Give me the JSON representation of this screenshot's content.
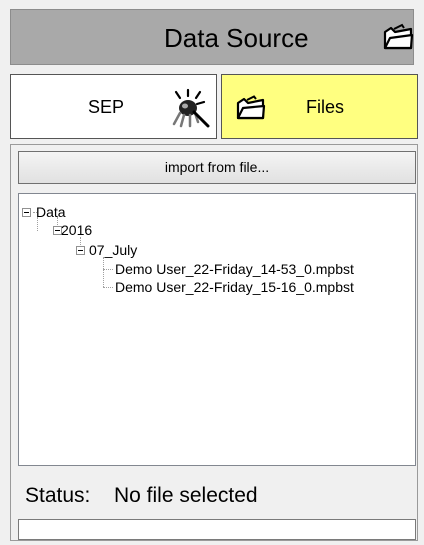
{
  "header": {
    "title": "Data Source",
    "icon": "folder-open-icon"
  },
  "tabs": {
    "sep": {
      "label": "SEP",
      "icon": "sep-probe-icon"
    },
    "files": {
      "label": "Files",
      "icon": "folder-open-icon",
      "active": true
    }
  },
  "import_button": {
    "label": "import from file..."
  },
  "tree": {
    "root": "Data",
    "year": "2016",
    "month": "07_July",
    "files": [
      "Demo User_22-Friday_14-53_0.mpbst",
      "Demo User_22-Friday_15-16_0.mpbst"
    ]
  },
  "status": {
    "label": "Status:",
    "value": "No file selected",
    "field_value": ""
  },
  "colors": {
    "header_bg": "#a9a9a9",
    "active_tab_bg": "#ffff80",
    "inactive_tab_bg": "#ffffff"
  }
}
